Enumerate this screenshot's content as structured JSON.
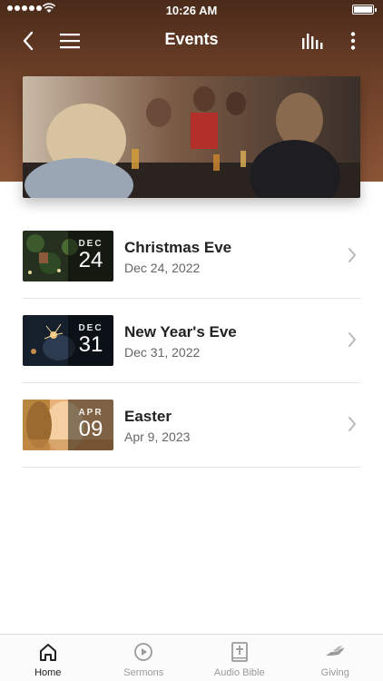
{
  "status_bar": {
    "time": "10:26 AM"
  },
  "nav": {
    "title": "Events",
    "back_icon": "back-chevron-icon",
    "menu_icon": "hamburger-icon",
    "audio_icon": "audio-levels-icon",
    "more_icon": "more-vertical-icon"
  },
  "hero": {
    "image": "people-dining-together-photo"
  },
  "events": [
    {
      "title": "Christmas Eve",
      "date": "Dec 24, 2022",
      "month": "DEC",
      "day": "24",
      "thumb": "christmas-tree-photo"
    },
    {
      "title": "New Year's Eve",
      "date": "Dec 31, 2022",
      "month": "DEC",
      "day": "31",
      "thumb": "sparkler-photo"
    },
    {
      "title": "Easter",
      "date": "Apr 9, 2023",
      "month": "APR",
      "day": "09",
      "thumb": "tomb-stone-photo"
    }
  ],
  "tabs": [
    {
      "label": "Home",
      "icon": "home-icon",
      "active": true
    },
    {
      "label": "Sermons",
      "icon": "play-circle-icon",
      "active": false
    },
    {
      "label": "Audio Bible",
      "icon": "bible-icon",
      "active": false
    },
    {
      "label": "Giving",
      "icon": "giving-hand-icon",
      "active": false
    }
  ],
  "colors": {
    "header_top": "#4a2a1a",
    "header_bottom": "#8a5436",
    "text_primary": "#222222",
    "text_secondary": "#666666"
  }
}
